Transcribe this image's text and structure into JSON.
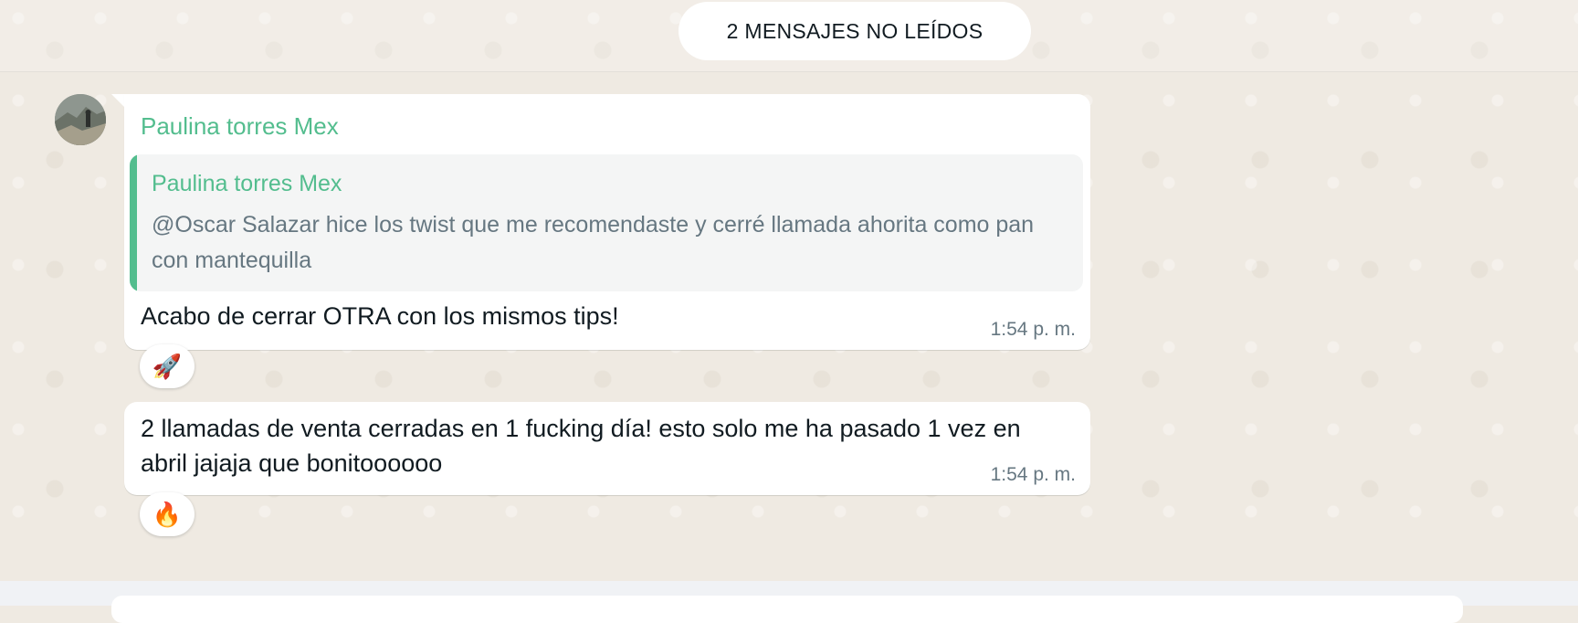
{
  "unread_banner": {
    "label": "2 MENSAJES NO LEÍDOS"
  },
  "messages": [
    {
      "sender": "Paulina torres Mex",
      "quoted": {
        "author": "Paulina torres Mex",
        "text": "@Oscar Salazar hice los twist que me recomendaste y cerré llamada ahorita como pan con mantequilla"
      },
      "text": "Acabo de cerrar OTRA con los mismos tips!",
      "time": "1:54 p. m.",
      "reaction": "🚀"
    },
    {
      "text": "2 llamadas de venta cerradas en 1 fucking día! esto solo me ha pasado 1 vez en abril jajaja que bonitoooooo",
      "time": "1:54 p. m.",
      "reaction": "🔥"
    }
  ],
  "colors": {
    "chat_background": "#efeae2",
    "sender_name": "#53bd8e",
    "quote_bar": "#53bd8e",
    "bubble": "#ffffff",
    "meta_text": "#667781"
  }
}
